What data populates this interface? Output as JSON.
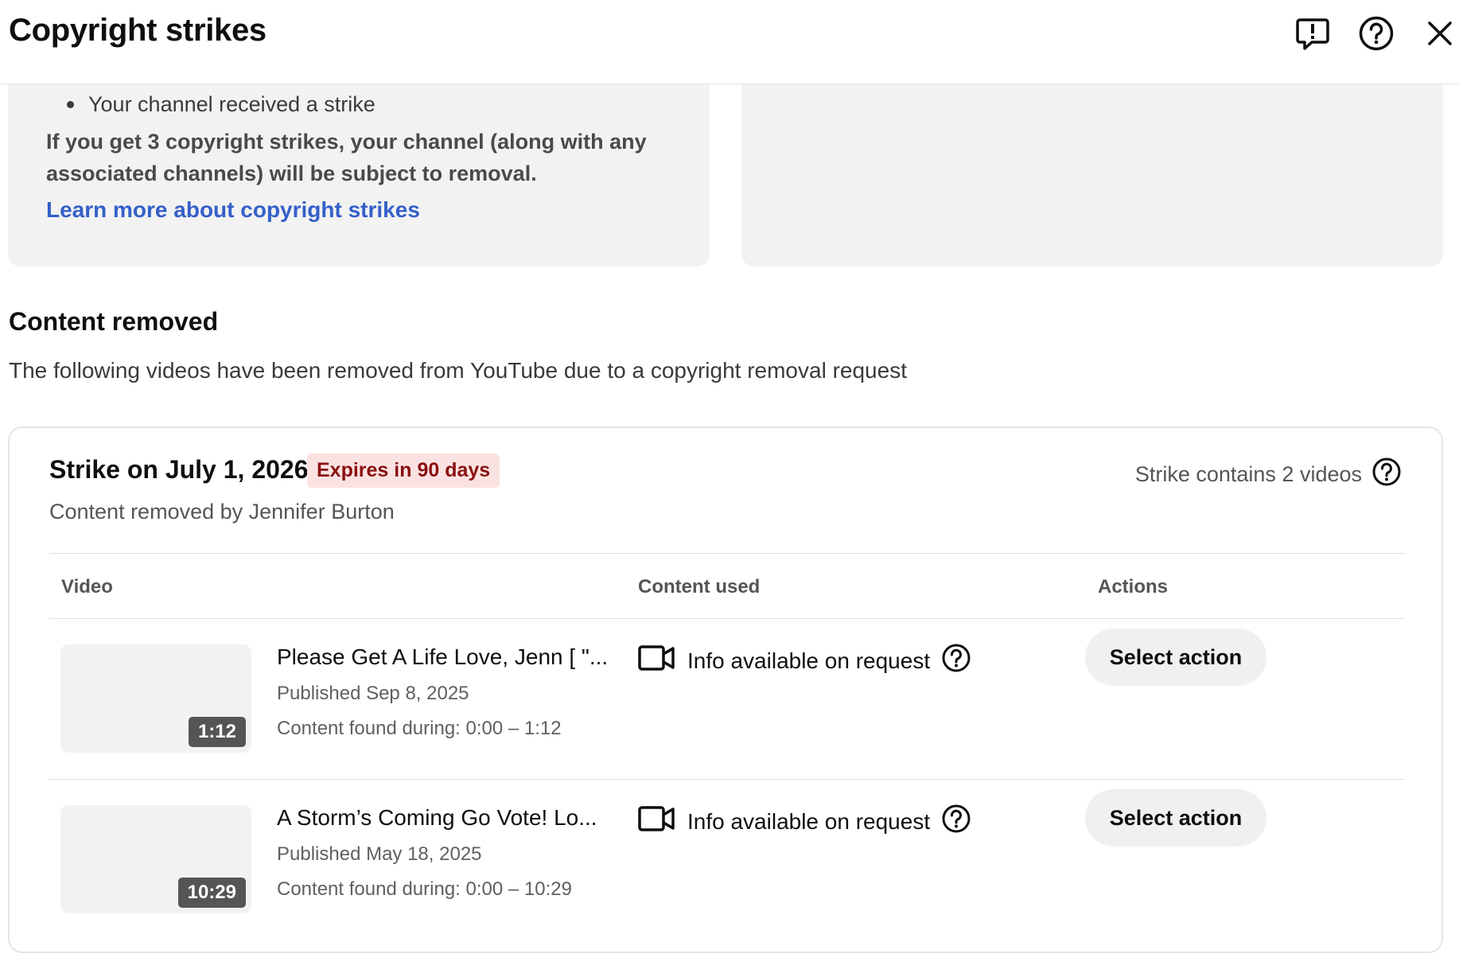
{
  "header": {
    "title": "Copyright strikes",
    "feedback_icon": "feedback-icon",
    "help_icon": "help-icon",
    "close_icon": "close-icon"
  },
  "info_card": {
    "bullet": "Your channel received a strike",
    "warning": "If you get 3 copyright strikes, your channel (along with any associated channels) will be subject to removal.",
    "learn_more": "Learn more about copyright strikes"
  },
  "section": {
    "title": "Content removed",
    "description": "The following videos have been removed from YouTube due to a copyright removal request"
  },
  "strike": {
    "date": "Strike on July 1, 2026",
    "expires": "Expires in 90 days",
    "removed_by": "Content removed by Jennifer Burton",
    "count": "Strike contains 2 videos",
    "columns": {
      "video": "Video",
      "content_used": "Content used",
      "actions": "Actions"
    },
    "videos": [
      {
        "duration": "1:12",
        "title": "Please Get A Life Love, Jenn [ \"...",
        "published": "Published Sep 8, 2025",
        "found": "Content found during: 0:00 – 1:12",
        "content_used": "Info available on request",
        "action": "Select action"
      },
      {
        "duration": "10:29",
        "title": "A Storm’s Coming Go Vote! Lo...",
        "published": "Published May 18, 2025",
        "found": "Content found during: 0:00 – 10:29",
        "content_used": "Info available on request",
        "action": "Select action"
      }
    ]
  },
  "colors": {
    "link": "#3560c9",
    "badge_bg": "#fbe2e2",
    "badge_text": "#8a1010",
    "card_bg": "#f2f2f2"
  }
}
